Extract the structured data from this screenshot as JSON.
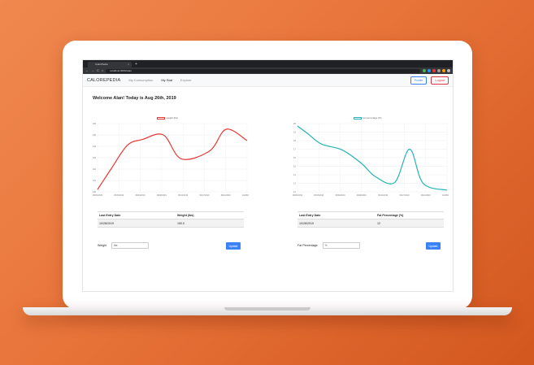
{
  "browser": {
    "tab_title": "CaloriPedia",
    "tab_close": "×",
    "new_tab": "+",
    "url": "localhost:3000/stats",
    "nav": {
      "back": "←",
      "forward": "→",
      "reload": "C",
      "home": "⌂"
    }
  },
  "app": {
    "brand": "CALOREPEDIA",
    "nav": [
      {
        "label": "My Consumption",
        "active": false
      },
      {
        "label": "My Stat",
        "active": true
      },
      {
        "label": "Explore",
        "active": false
      }
    ],
    "profile_label": "Profile",
    "logout_label": "Logout"
  },
  "welcome": "Welcome Alan! Today is Aug 26th, 2019",
  "weight_panel": {
    "table_headers": [
      "Last Entry Date",
      "Weight (lbs)"
    ],
    "table_row": [
      "10/28/2019",
      "150.0"
    ],
    "form_label": "Weight",
    "form_placeholder": "lbs",
    "button_label": "Update"
  },
  "fat_panel": {
    "table_headers": [
      "Last Entry Date",
      "Fat Percentage (%)"
    ],
    "table_row": [
      "10/28/2019",
      "12"
    ],
    "form_label": "Fat Percentage",
    "form_placeholder": "%",
    "button_label": "Update"
  },
  "chart_data": [
    {
      "type": "line",
      "legend": "weight (lbs)",
      "color": "#e53935",
      "x": [
        "08/26/2019",
        "08/30/2019",
        "09/03/2019",
        "09/08/2019",
        "09/12/2019",
        "09/17/2019",
        "09/21/2019",
        "10/28/2019"
      ],
      "ylim": [
        140,
        146
      ],
      "yticks": [
        140,
        141,
        142,
        143,
        144,
        145,
        146
      ],
      "x_values": [
        0,
        0.09,
        0.2,
        0.3,
        0.44,
        0.56,
        0.75,
        0.86,
        1.0
      ],
      "values": [
        140.2,
        142.0,
        144.1,
        144.6,
        145.0,
        142.9,
        143.6,
        145.5,
        144.5
      ]
    },
    {
      "type": "line",
      "legend": "fat percentage (%)",
      "color": "#26b3b3",
      "x": [
        "08/26/2019",
        "08/30/2019",
        "09/03/2019",
        "09/08/2019",
        "09/12/2019",
        "09/17/2019",
        "09/21/2019",
        "10/28/2019"
      ],
      "ylim": [
        12,
        20
      ],
      "yticks": [
        12,
        13,
        14,
        15,
        16,
        17,
        18,
        19,
        20
      ],
      "x_values": [
        0,
        0.07,
        0.16,
        0.3,
        0.43,
        0.52,
        0.65,
        0.75,
        0.84,
        1.0
      ],
      "values": [
        19.7,
        18.8,
        17.6,
        16.9,
        15.3,
        13.8,
        13.1,
        17.0,
        13.0,
        12.2
      ]
    }
  ],
  "colors": {
    "primary": "#3b82f6",
    "danger": "#dc3545",
    "weight_line": "#e53935",
    "fat_line": "#26b3b3",
    "background_start": "#f0894f",
    "background_end": "#d2571f"
  }
}
